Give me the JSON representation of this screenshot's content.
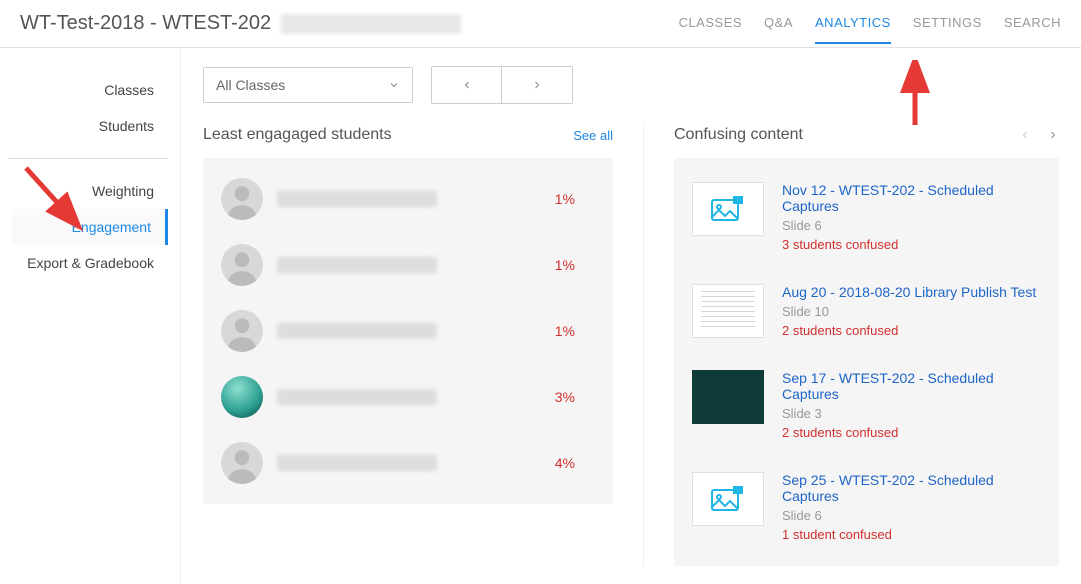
{
  "header": {
    "title": "WT-Test-2018 - WTEST-202",
    "nav": {
      "classes": "CLASSES",
      "qa": "Q&A",
      "analytics": "ANALYTICS",
      "settings": "SETTINGS",
      "search": "SEARCH"
    }
  },
  "sidebar": {
    "classes": "Classes",
    "students": "Students",
    "weighting": "Weighting",
    "engagement": "Engagement",
    "export": "Export & Gradebook"
  },
  "controls": {
    "selector_label": "All Classes"
  },
  "least_engaged": {
    "title": "Least engagaged students",
    "see_all": "See all",
    "students": [
      {
        "percent": "1%"
      },
      {
        "percent": "1%"
      },
      {
        "percent": "1%"
      },
      {
        "percent": "3%"
      },
      {
        "percent": "4%"
      }
    ]
  },
  "confusing": {
    "title": "Confusing content",
    "items": [
      {
        "title": "Nov 12 - WTEST-202 - Scheduled Captures",
        "slide": "Slide 6",
        "confused": "3 students confused",
        "thumb": "media"
      },
      {
        "title": "Aug 20 - 2018-08-20 Library Publish Test",
        "slide": "Slide 10",
        "confused": "2 students confused",
        "thumb": "doc"
      },
      {
        "title": "Sep 17 - WTEST-202 - Scheduled Captures",
        "slide": "Slide 3",
        "confused": "2 students confused",
        "thumb": "dark"
      },
      {
        "title": "Sep 25 - WTEST-202 - Scheduled Captures",
        "slide": "Slide 6",
        "confused": "1 student confused",
        "thumb": "media"
      }
    ]
  }
}
